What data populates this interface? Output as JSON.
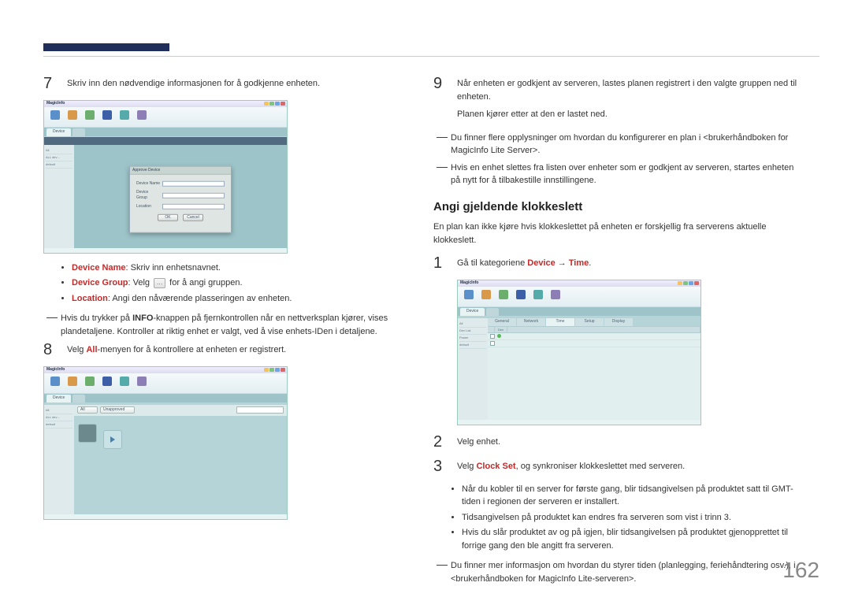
{
  "pageNumber": "162",
  "left": {
    "step7": {
      "num": "7",
      "text": "Skriv inn den nødvendige informasjonen for å godkjenne enheten."
    },
    "dialog": {
      "title": "Approve Device",
      "fields": {
        "deviceName": "Device Name",
        "deviceGroup": "Device Group",
        "location": "Location"
      },
      "buttons": {
        "ok": "OK",
        "cancel": "Cancel"
      }
    },
    "bullets7": {
      "deviceNameLabel": "Device Name",
      "deviceNameText": ": Skriv inn enhetsnavnet.",
      "deviceGroupLabel": "Device Group",
      "deviceGroupPre": ": Velg ",
      "deviceGroupBtn": "…",
      "deviceGroupPost": " for å angi gruppen.",
      "locationLabel": "Location",
      "locationText": ": Angi den nåværende plasseringen av enheten."
    },
    "note7a": "Hvis du trykker på ",
    "note7info": "INFO",
    "note7b": "-knappen på fjernkontrollen når en nettverksplan kjører, vises plandetaljene. Kontroller at riktig enhet er valgt, ved å vise enhets-IDen i detaljene.",
    "step8": {
      "num": "8",
      "pre": "Velg ",
      "all": "All",
      "post": "-menyen for å kontrollere at enheten er registrert."
    },
    "mock2": {
      "dd1": "Unapproved",
      "ddAll": "All"
    }
  },
  "right": {
    "step9": {
      "num": "9",
      "text1": "Når enheten er godkjent av serveren, lastes planen registrert i den valgte gruppen ned til enheten.",
      "text2": "Planen kjører etter at den er lastet ned."
    },
    "note9a": "Du finner flere opplysninger om hvordan du konfigurerer en plan i <brukerhåndboken for MagicInfo Lite Server>.",
    "note9b": "Hvis en enhet slettes fra listen over enheter som er godkjent av serveren, startes enheten på nytt for å tilbakestille innstillingene.",
    "sectionTitle": "Angi gjeldende klokkeslett",
    "sectionPara": "En plan kan ikke kjøre hvis klokkeslettet på enheten er forskjellig fra serverens aktuelle klokkeslett.",
    "step1": {
      "num": "1",
      "pre": "Gå til kategoriene ",
      "device": "Device",
      "arrow": "→",
      "time": "Time",
      "post": "."
    },
    "mock3": {
      "tabs": {
        "general": "General",
        "network": "Network",
        "time": "Time",
        "setup": "Setup",
        "display": "Display"
      }
    },
    "step2": {
      "num": "2",
      "text": "Velg enhet."
    },
    "step3": {
      "num": "3",
      "pre": "Velg ",
      "clockSet": "Clock Set",
      "post": ", og synkroniser klokkeslettet med serveren."
    },
    "bullets3": {
      "b1": "Når du kobler til en server for første gang, blir tidsangivelsen på produktet satt til GMT-tiden i regionen der serveren er installert.",
      "b2": "Tidsangivelsen på produktet kan endres fra serveren som vist i trinn 3.",
      "b3": "Hvis du slår produktet av og på igjen, blir tidsangivelsen på produktet gjenopprettet til forrige gang den ble angitt fra serveren."
    },
    "noteFinal": "Du finner mer informasjon om hvordan du styrer tiden (planlegging, feriehåndtering osv.), i <brukerhåndboken for MagicInfo Lite-serveren>."
  },
  "mockCommon": {
    "logo": "MagicInfo"
  }
}
